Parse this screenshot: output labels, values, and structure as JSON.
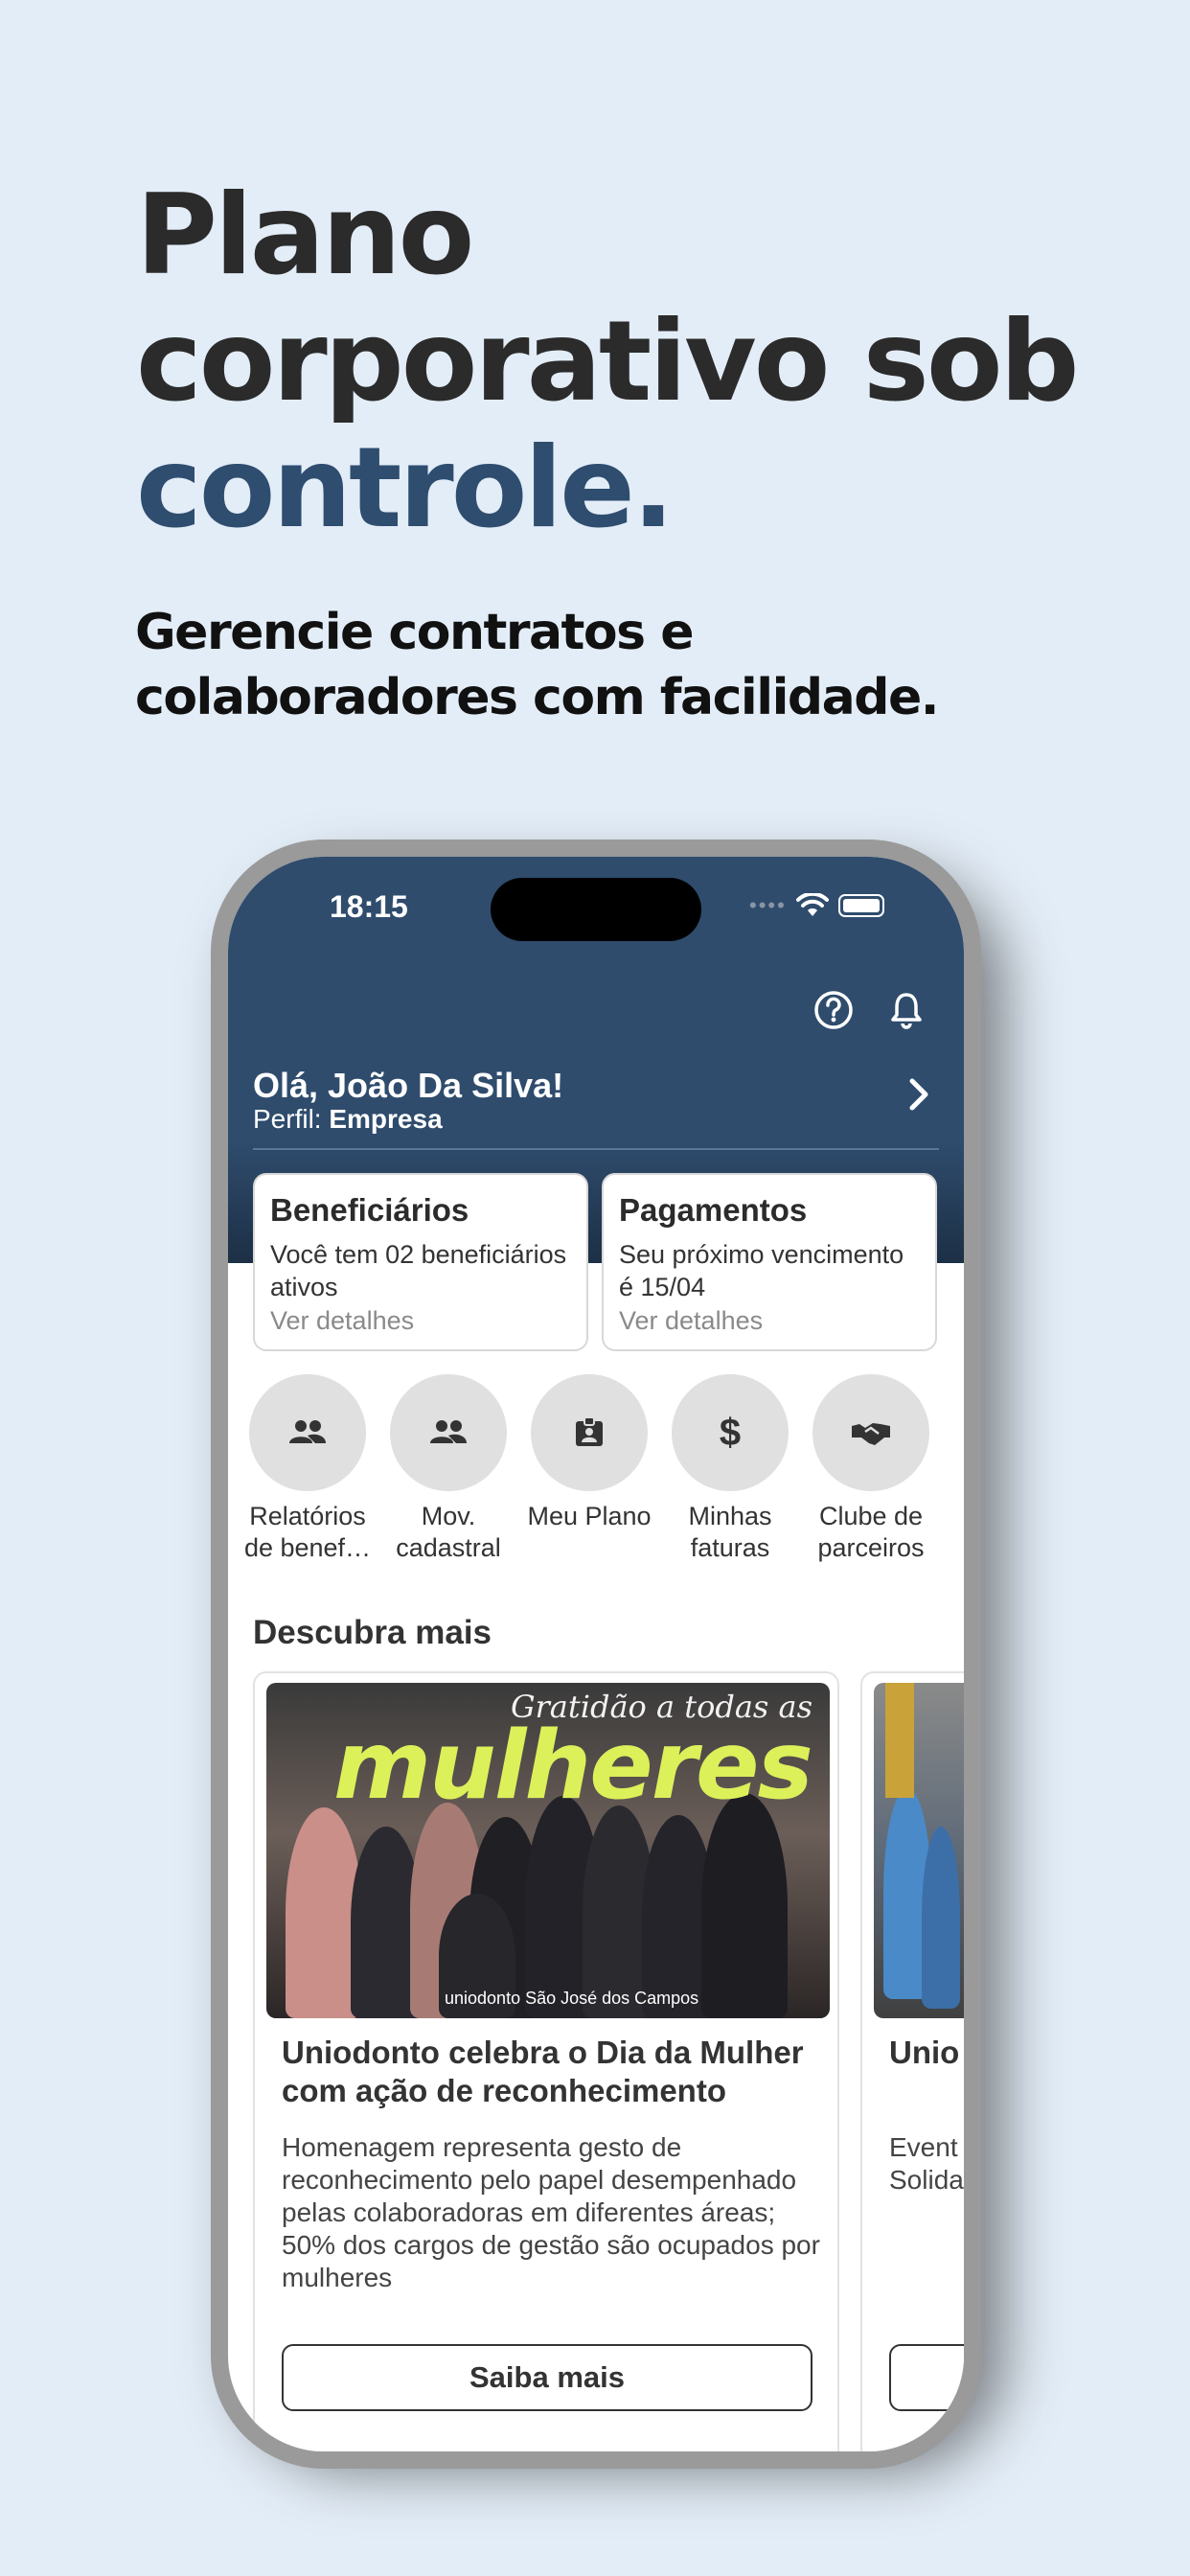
{
  "headline": {
    "line1": "Plano",
    "line2": "corporativo sob",
    "accent": "controle."
  },
  "subhead": {
    "line1": "Gerencie contratos e",
    "line2": "colaboradores com facilidade."
  },
  "status_bar": {
    "time": "18:15"
  },
  "header": {
    "greeting": "Olá, João Da Silva!",
    "profile_label": "Perfil:",
    "profile_value": "Empresa",
    "icons": [
      "help-icon",
      "bell-icon",
      "chevron-right-icon"
    ]
  },
  "cards": [
    {
      "title": "Beneficiários",
      "desc": "Você tem 02 beneficiários ativos",
      "link": "Ver detalhes"
    },
    {
      "title": "Pagamentos",
      "desc": "Seu próximo vencimento é 15/04",
      "link": "Ver detalhes"
    }
  ],
  "shortcuts": [
    {
      "line1": "Relatórios",
      "line2": "de benef…",
      "icon": "users-icon"
    },
    {
      "line1": "Mov.",
      "line2": "cadastral",
      "icon": "users-icon"
    },
    {
      "line1": "Meu Plano",
      "line2": "",
      "icon": "id-card-icon"
    },
    {
      "line1": "Minhas",
      "line2": "faturas",
      "icon": "dollar-icon"
    },
    {
      "line1": "Clube de",
      "line2": "parceiros",
      "icon": "handshake-icon"
    }
  ],
  "discover": {
    "title": "Descubra mais",
    "news": [
      {
        "image_caption": "Gratidão a todas as",
        "image_title": "mulheres",
        "image_brand": "uniodonto  São José dos Campos",
        "title": "Uniodonto celebra o Dia da Mulher com ação de reconhecimento",
        "desc": "Homenagem representa gesto de reconhecimento pelo papel desempenhado pelas colaboradoras em diferentes áreas; 50% dos cargos de gestão são ocupados por mulheres",
        "button": "Saiba mais"
      },
      {
        "title": "Unio Cam Cara",
        "desc": "Event Come com a Solida",
        "button": ""
      }
    ]
  },
  "colors": {
    "background": "#e3edf7",
    "header": "#2f4c6d",
    "accent": "#2e4d6f",
    "image_title": "#dcf05a"
  }
}
